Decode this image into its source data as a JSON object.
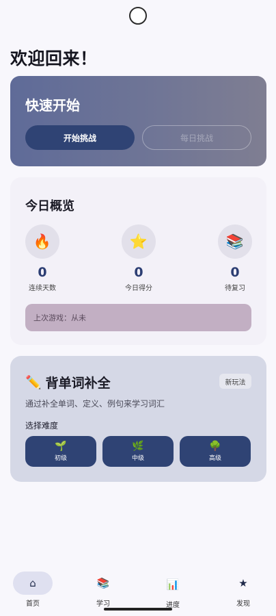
{
  "header": {
    "welcome": "欢迎回来！"
  },
  "quick_start": {
    "title": "快速开始",
    "start_label": "开始挑战",
    "daily_label": "每日挑战"
  },
  "overview": {
    "title": "今日概览",
    "stats": [
      {
        "icon": "🔥",
        "icon_name": "fire-icon",
        "value": "0",
        "label": "连续天数"
      },
      {
        "icon": "⭐",
        "icon_name": "star-icon",
        "value": "0",
        "label": "今日得分"
      },
      {
        "icon": "📚",
        "icon_name": "books-icon",
        "value": "0",
        "label": "待复习"
      }
    ],
    "last_game": "上次游戏：从未"
  },
  "word_game": {
    "icon": "✏️",
    "title": "背单词补全",
    "badge": "新玩法",
    "description": "通过补全单词、定义、例句来学习词汇",
    "difficulty_label": "选择难度",
    "levels": [
      {
        "icon": "🌱",
        "label": "初级"
      },
      {
        "icon": "🌿",
        "label": "中级"
      },
      {
        "icon": "🌳",
        "label": "高级"
      }
    ]
  },
  "nav": {
    "items": [
      {
        "icon": "⌂",
        "label": "首页",
        "active": true
      },
      {
        "icon": "📚",
        "label": "学习"
      },
      {
        "icon": "📊",
        "label": "进度"
      },
      {
        "icon": "★",
        "label": "发现"
      }
    ]
  },
  "colors": {
    "accent": "#2f4374",
    "background": "#f8f7fc",
    "last_game_bg": "#c2afc3"
  }
}
